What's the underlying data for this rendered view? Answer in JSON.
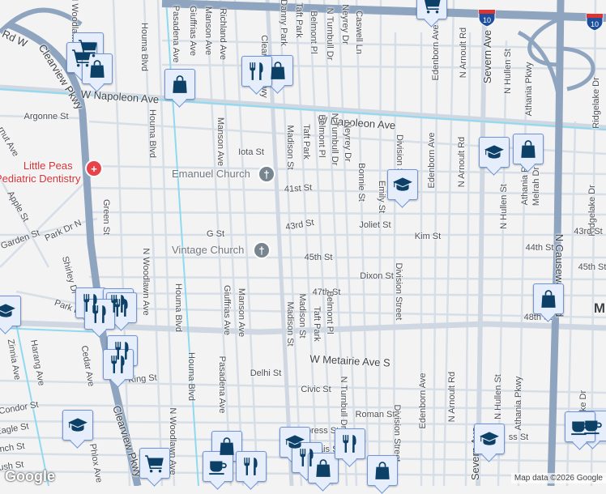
{
  "map": {
    "attribution": "Map data ©2026 Google",
    "logo": "Google",
    "area_label": "M",
    "interstate": "10",
    "places": {
      "dentistry_line1": "Little Peas",
      "dentistry_line2": "Pediatric Dentistry",
      "church1": "Emanuel Church",
      "church2": "Vintage Church"
    },
    "streets": [
      "W Napoleon Ave",
      "W Napoleon Ave",
      "W Metairie Ave S",
      "Rd W",
      "Clearview Pkwy",
      "Clearview Pkwy",
      "Clearview Pkwy",
      "N Causeway Blvd",
      "Houma Blvd",
      "Pasadena Ave",
      "Giuffrias Ave",
      "Manson Ave",
      "Richland Ave",
      "Danny Park",
      "Taft Park",
      "Belmont Pl",
      "N Turnbull Dr",
      "Neyrey Dr",
      "Caswell Ln",
      "Edenborn Ave",
      "N Arnoult Rd",
      "Severn Ave",
      "N Hullen St",
      "Athania Pkwy",
      "Ridgelake Dr",
      "Houma Blvd",
      "Manson Ave",
      "Madison St",
      "Taft Park",
      "Belmont Pl",
      "N Turnbull Dr",
      "Neyrey Dr",
      "Division St",
      "Edenborn Ave",
      "N Arnoult Rd",
      "Bonnie St",
      "Emily St",
      "N Hullen St",
      "Athania Pkwy",
      "Melrah Dr",
      "Ridgelake Dr",
      "Green St",
      "Apple St",
      "rnut Ave",
      "Argonne St",
      "Iota St",
      "41st St",
      "43rd St",
      "G St",
      "45th St",
      "Joliet St",
      "Kim St",
      "43rd St",
      "44th St",
      "45th St",
      "Dixon St",
      "47th St",
      "48th St",
      "Madison St",
      "Taft Park",
      "Belmont Pl",
      "Giuffrias Ave",
      "Manson Ave",
      "N Woodlawn Ave",
      "Houma Blvd",
      "Shirley Dr",
      "Garden St",
      "Park Dr N",
      "Park Dr",
      "Delhi St",
      "Civic St",
      "Roman St",
      "King St",
      "Houma Blvd",
      "Pasadena Ave",
      "N Woodlawn Ave",
      "Cedar Ave",
      "Harang Ave",
      "Zinnia Ave",
      "Phlox Ave",
      "Condor St",
      "Eagle St",
      "nch St",
      "rush St",
      "N Turnbull Dr",
      "Division Street",
      "Division Street",
      "Edenborn Ave",
      "N Arnoult Rd",
      "N Hullen St",
      "Athania Pkwy",
      "Severn Ave",
      "ss St",
      "press St",
      "vais St",
      "ke Dr",
      "N Woodlawn Ave",
      "Madison St"
    ],
    "colors": {
      "highway": "#8ea4bf",
      "canal": "#8fdaf0",
      "road": "#d5dde6",
      "marker_fill": "#e6eefc",
      "marker_icon": "#0d4066",
      "dentist": "#e8424a",
      "church": "#78858f"
    }
  }
}
